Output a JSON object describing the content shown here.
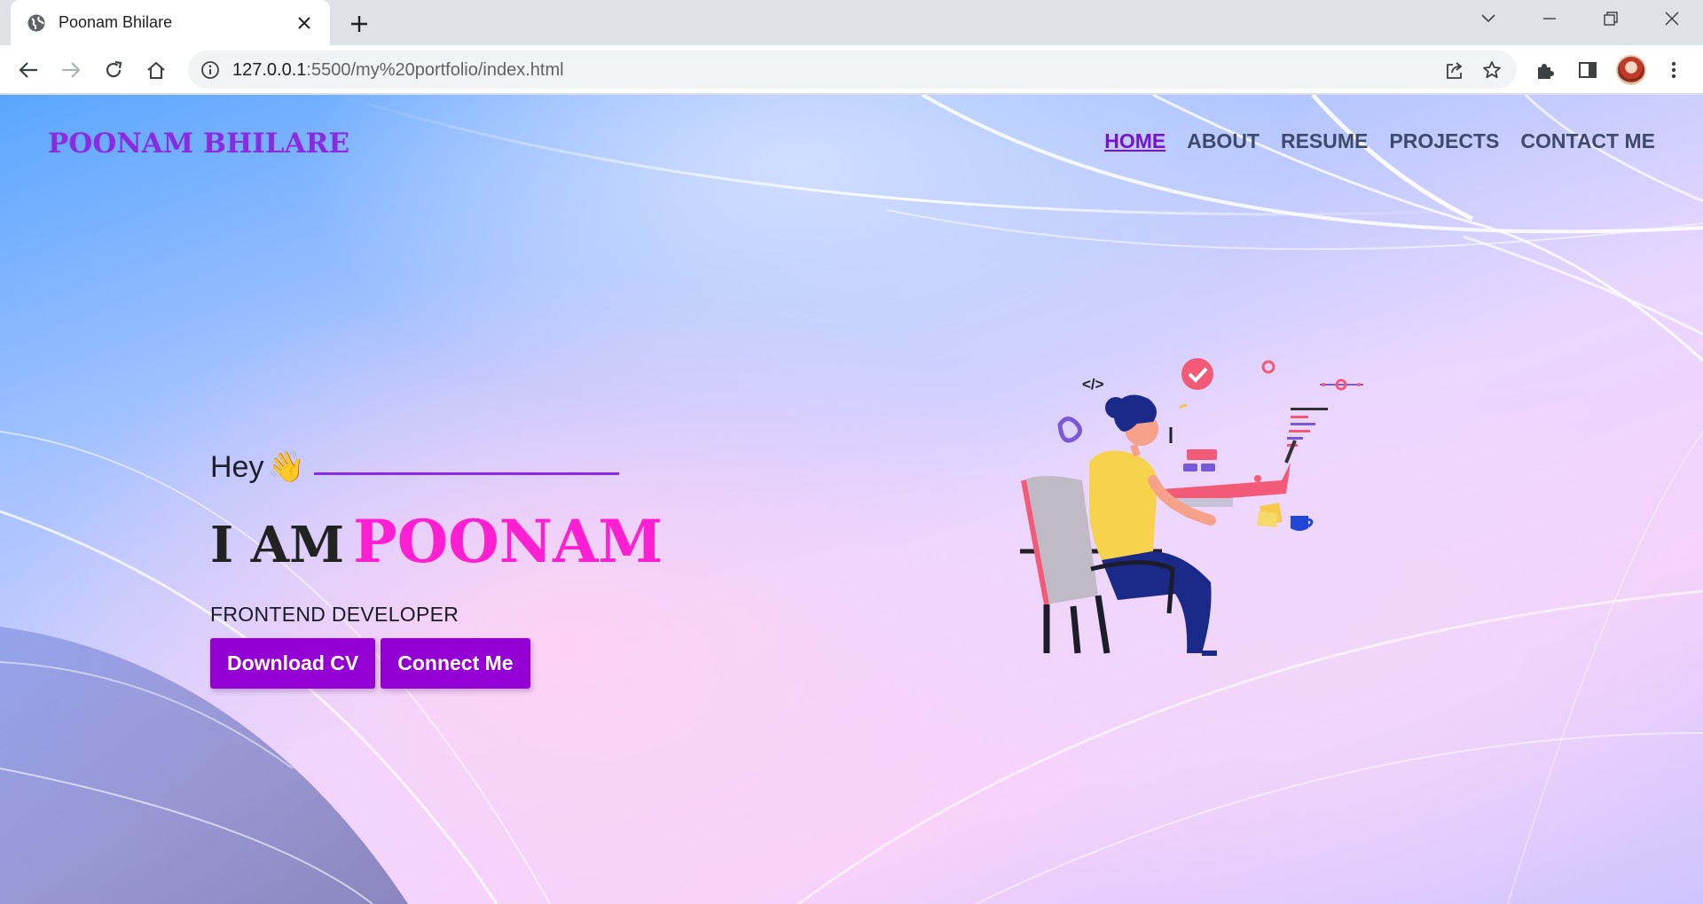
{
  "browser": {
    "tab_title": "Poonam Bhilare",
    "url_host": "127.0.0.1",
    "url_rest": ":5500/my%20portfolio/index.html"
  },
  "header": {
    "logo": "POONAM BHILARE",
    "nav": [
      {
        "label": "HOME",
        "active": true
      },
      {
        "label": "ABOUT",
        "active": false
      },
      {
        "label": "RESUME",
        "active": false
      },
      {
        "label": "PROJECTS",
        "active": false
      },
      {
        "label": "CONTACT ME",
        "active": false
      }
    ]
  },
  "hero": {
    "greeting": "Hey",
    "wave": "👋",
    "intro": "I AM",
    "name": "POONAM",
    "role": "FRONTEND DEVELOPER",
    "buttons": {
      "download": "Download CV",
      "connect": "Connect Me"
    },
    "illustration_code_tag": "</>"
  },
  "colors": {
    "accent": "#8a2be2",
    "name_pink": "#ff1fd2",
    "button_bg": "#9400d3",
    "nav_text": "#3f4a6b"
  }
}
